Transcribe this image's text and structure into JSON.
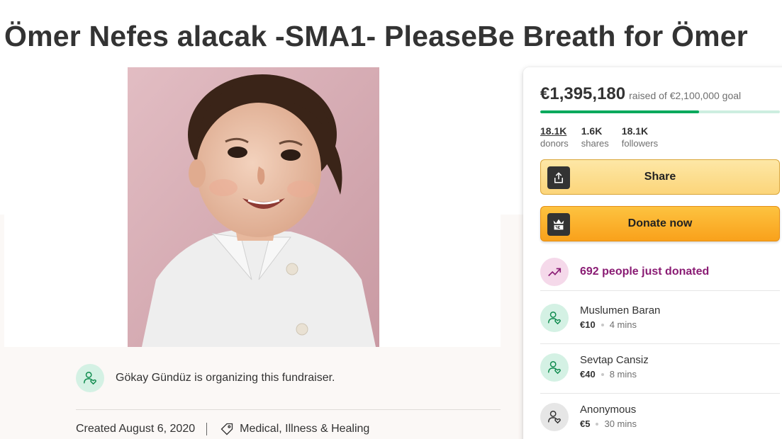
{
  "page": {
    "title": "Ömer Nefes alacak -SMA1- PleaseBe Breath for Ömer"
  },
  "organizer": {
    "text": "Gökay Gündüz is organizing this fundraiser.",
    "icon": "user-heart-icon"
  },
  "meta": {
    "created": "Created August 6, 2020",
    "category": "Medical, Illness & Healing",
    "category_icon": "tag-icon"
  },
  "donation": {
    "raised": "€1,395,180",
    "goal_text": "raised of €2,100,000 goal",
    "progress_fraction": 0.664,
    "stats": [
      {
        "value": "18.1K",
        "label": "donors"
      },
      {
        "value": "1.6K",
        "label": "shares"
      },
      {
        "value": "18.1K",
        "label": "followers"
      }
    ],
    "share_label": "Share",
    "donate_label": "Donate now",
    "recent_text": "692 people just donated",
    "donors": [
      {
        "name": "Muslumen Baran",
        "amount": "€10",
        "time": "4 mins"
      },
      {
        "name": "Sevtap Cansiz",
        "amount": "€40",
        "time": "8 mins"
      },
      {
        "name": "Anonymous",
        "amount": "€5",
        "time": "30 mins"
      }
    ]
  },
  "colors": {
    "brand_green": "#02a95c",
    "progress_track": "#cdeee0",
    "donate_orange": "#f9a11b",
    "share_yellow": "#fcd57a",
    "recent_purple": "#8a1c74"
  }
}
